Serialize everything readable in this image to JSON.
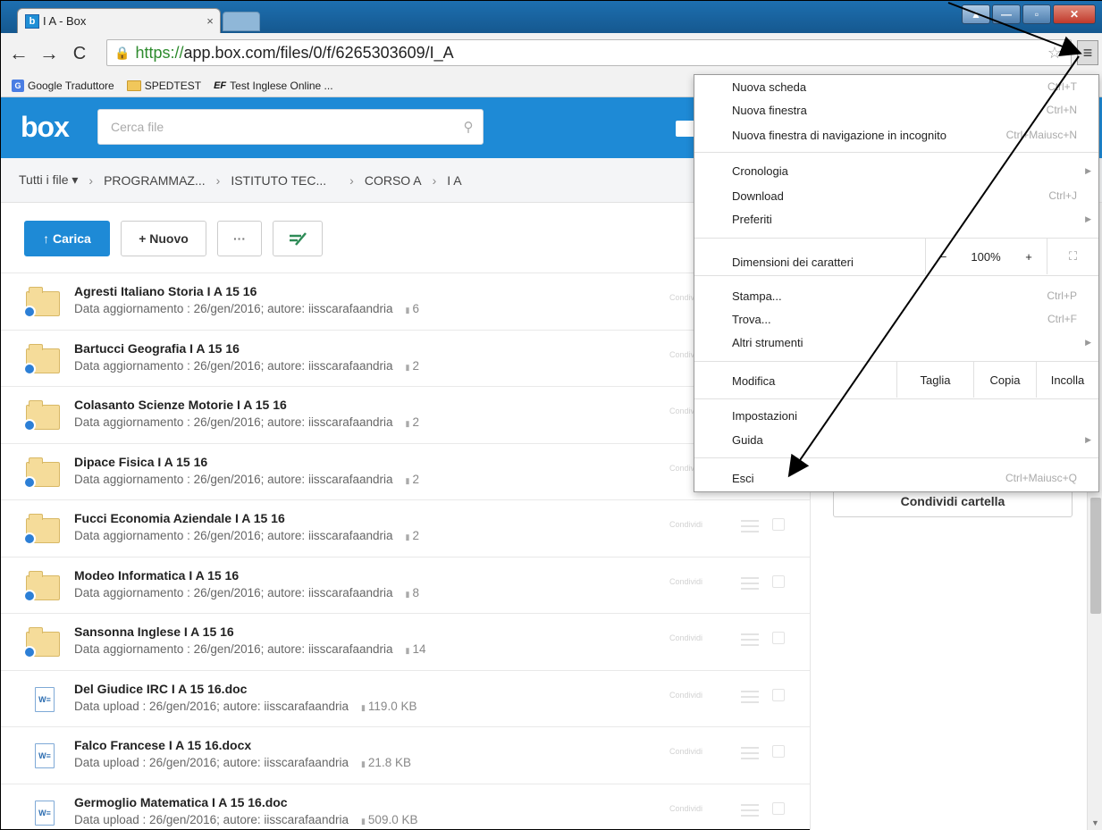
{
  "browser": {
    "tab_title": "I A - Box",
    "tab_close": "×",
    "favicon_letter": "b",
    "window_controls": {
      "user": "▲",
      "minimize": "—",
      "maximize": "▫",
      "close": "✕"
    },
    "url_protocol": "https://",
    "url_rest": "app.box.com/files/0/f/6265303609/I_A",
    "bookmarks": [
      {
        "label": "Google Traduttore"
      },
      {
        "label": "SPEDTEST"
      },
      {
        "label": "Test Inglese Online ...",
        "prefix": "EF"
      }
    ]
  },
  "box": {
    "logo": "box",
    "search_placeholder": "Cerca file",
    "breadcrumb": [
      "Tutti i file ▾",
      "PROGRAMMAZ...",
      "ISTITUTO TEC...",
      "CORSO A",
      "I A"
    ],
    "breadcrumb_sep": "›",
    "actions": {
      "upload": "↑ Carica",
      "new": "+ Nuovo",
      "more": "···",
      "notes": "⁼̸"
    },
    "row_action_label": "Condividi",
    "share_folder": "Condividi cartella",
    "files": [
      {
        "name": "Agresti Italiano Storia I A 15 16",
        "meta": "Data aggiornamento : 26/gen/2016; autore: iisscarafaandria",
        "count": "6",
        "kind": "folder"
      },
      {
        "name": "Bartucci Geografia I A 15 16",
        "meta": "Data aggiornamento : 26/gen/2016; autore: iisscarafaandria",
        "count": "2",
        "kind": "folder"
      },
      {
        "name": "Colasanto Scienze Motorie I A 15 16",
        "meta": "Data aggiornamento : 26/gen/2016; autore: iisscarafaandria",
        "count": "2",
        "kind": "folder"
      },
      {
        "name": "Dipace Fisica I A 15 16",
        "meta": "Data aggiornamento : 26/gen/2016; autore: iisscarafaandria",
        "count": "2",
        "kind": "folder"
      },
      {
        "name": "Fucci Economia Aziendale I A 15 16",
        "meta": "Data aggiornamento : 26/gen/2016; autore: iisscarafaandria",
        "count": "2",
        "kind": "folder"
      },
      {
        "name": "Modeo Informatica I A 15 16",
        "meta": "Data aggiornamento : 26/gen/2016; autore: iisscarafaandria",
        "count": "8",
        "kind": "folder"
      },
      {
        "name": "Sansonna Inglese I A 15 16",
        "meta": "Data aggiornamento : 26/gen/2016; autore: iisscarafaandria",
        "count": "14",
        "kind": "folder"
      },
      {
        "name": "Del Giudice IRC I A 15 16.doc",
        "meta": "Data upload : 26/gen/2016; autore: iisscarafaandria",
        "count": "119.0 KB",
        "kind": "doc"
      },
      {
        "name": "Falco Francese I A 15 16.docx",
        "meta": "Data upload : 26/gen/2016; autore: iisscarafaandria",
        "count": "21.8 KB",
        "kind": "doc"
      },
      {
        "name": "Germoglio Matematica I A 15 16.doc",
        "meta": "Data upload : 26/gen/2016; autore: iisscarafaandria",
        "count": "509.0 KB",
        "kind": "doc"
      }
    ]
  },
  "menu": {
    "new_tab": "Nuova scheda",
    "new_tab_sc": "Ctrl+T",
    "new_window": "Nuova finestra",
    "new_window_sc": "Ctrl+N",
    "incognito": "Nuova finestra di navigazione in incognito",
    "incognito_sc": "Ctrl+Maiusc+N",
    "history": "Cronologia",
    "downloads": "Download",
    "downloads_sc": "Ctrl+J",
    "bookmarks": "Preferiti",
    "zoom_label": "Dimensioni dei caratteri",
    "zoom_minus": "−",
    "zoom_value": "100%",
    "zoom_plus": "+",
    "fullscreen": "⛶",
    "print": "Stampa...",
    "print_sc": "Ctrl+P",
    "find": "Trova...",
    "find_sc": "Ctrl+F",
    "more_tools": "Altri strumenti",
    "edit_label": "Modifica",
    "cut": "Taglia",
    "copy": "Copia",
    "paste": "Incolla",
    "settings": "Impostazioni",
    "help": "Guida",
    "exit": "Esci",
    "exit_sc": "Ctrl+Maiusc+Q",
    "submenu_arrow": "▶"
  }
}
